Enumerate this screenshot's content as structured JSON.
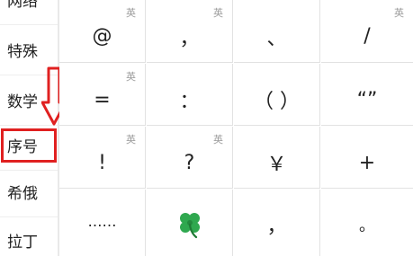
{
  "sidebar": {
    "items": [
      {
        "label": "网络"
      },
      {
        "label": "特殊"
      },
      {
        "label": "数学"
      },
      {
        "label": "序号"
      },
      {
        "label": "希俄"
      },
      {
        "label": "拉丁"
      }
    ],
    "highlighted_index": 3
  },
  "grid": {
    "rows": [
      [
        {
          "symbol": "@",
          "tag": "英"
        },
        {
          "symbol": "，",
          "tag": "英"
        },
        {
          "symbol": "、",
          "tag": ""
        },
        {
          "symbol": "/",
          "tag": "英"
        }
      ],
      [
        {
          "symbol": "=",
          "tag": "英"
        },
        {
          "symbol": "：",
          "tag": ""
        },
        {
          "symbol": "（ ）",
          "tag": ""
        },
        {
          "symbol": "“”",
          "tag": ""
        }
      ],
      [
        {
          "symbol": "!",
          "tag": "英"
        },
        {
          "symbol": "?",
          "tag": "英"
        },
        {
          "symbol": "￥",
          "tag": ""
        },
        {
          "symbol": "+",
          "tag": ""
        }
      ],
      [
        {
          "symbol": "……",
          "tag": ""
        },
        {
          "symbol": "clover-emoji",
          "tag": ""
        },
        {
          "symbol": "，",
          "tag": ""
        },
        {
          "symbol": "。",
          "tag": ""
        }
      ]
    ]
  },
  "colors": {
    "highlight": "#e02020",
    "clover": "#2fa84f"
  }
}
